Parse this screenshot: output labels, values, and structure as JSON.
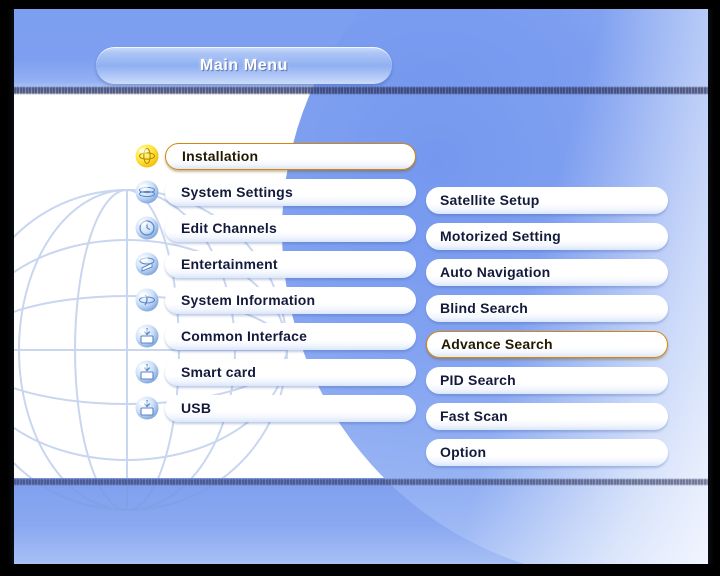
{
  "screen": {
    "title": "Main Menu",
    "accent_selected": "#ffd23c",
    "accent_selected_border": "#d4860a",
    "text_color": "#141a3c",
    "background_blue": "#7d9ff0"
  },
  "main_menu": {
    "items": [
      {
        "label": "Installation",
        "icon": "globe-sun-icon",
        "selected": true
      },
      {
        "label": "System Settings",
        "icon": "globe-settings-icon",
        "selected": false
      },
      {
        "label": "Edit Channels",
        "icon": "globe-clock-icon",
        "selected": false
      },
      {
        "label": "Entertainment",
        "icon": "globe-play-icon",
        "selected": false
      },
      {
        "label": "System Information",
        "icon": "globe-info-icon",
        "selected": false
      },
      {
        "label": "Common Interface",
        "icon": "globe-card-icon",
        "selected": false
      },
      {
        "label": "Smart card",
        "icon": "globe-smartcard-icon",
        "selected": false
      },
      {
        "label": "USB",
        "icon": "globe-usb-icon",
        "selected": false
      }
    ]
  },
  "submenu": {
    "items": [
      {
        "label": "Satellite Setup",
        "selected": false
      },
      {
        "label": "Motorized Setting",
        "selected": false
      },
      {
        "label": "Auto Navigation",
        "selected": false
      },
      {
        "label": "Blind Search",
        "selected": false
      },
      {
        "label": "Advance Search",
        "selected": true
      },
      {
        "label": "PID Search",
        "selected": false
      },
      {
        "label": "Fast Scan",
        "selected": false
      },
      {
        "label": "Option",
        "selected": false
      }
    ]
  }
}
